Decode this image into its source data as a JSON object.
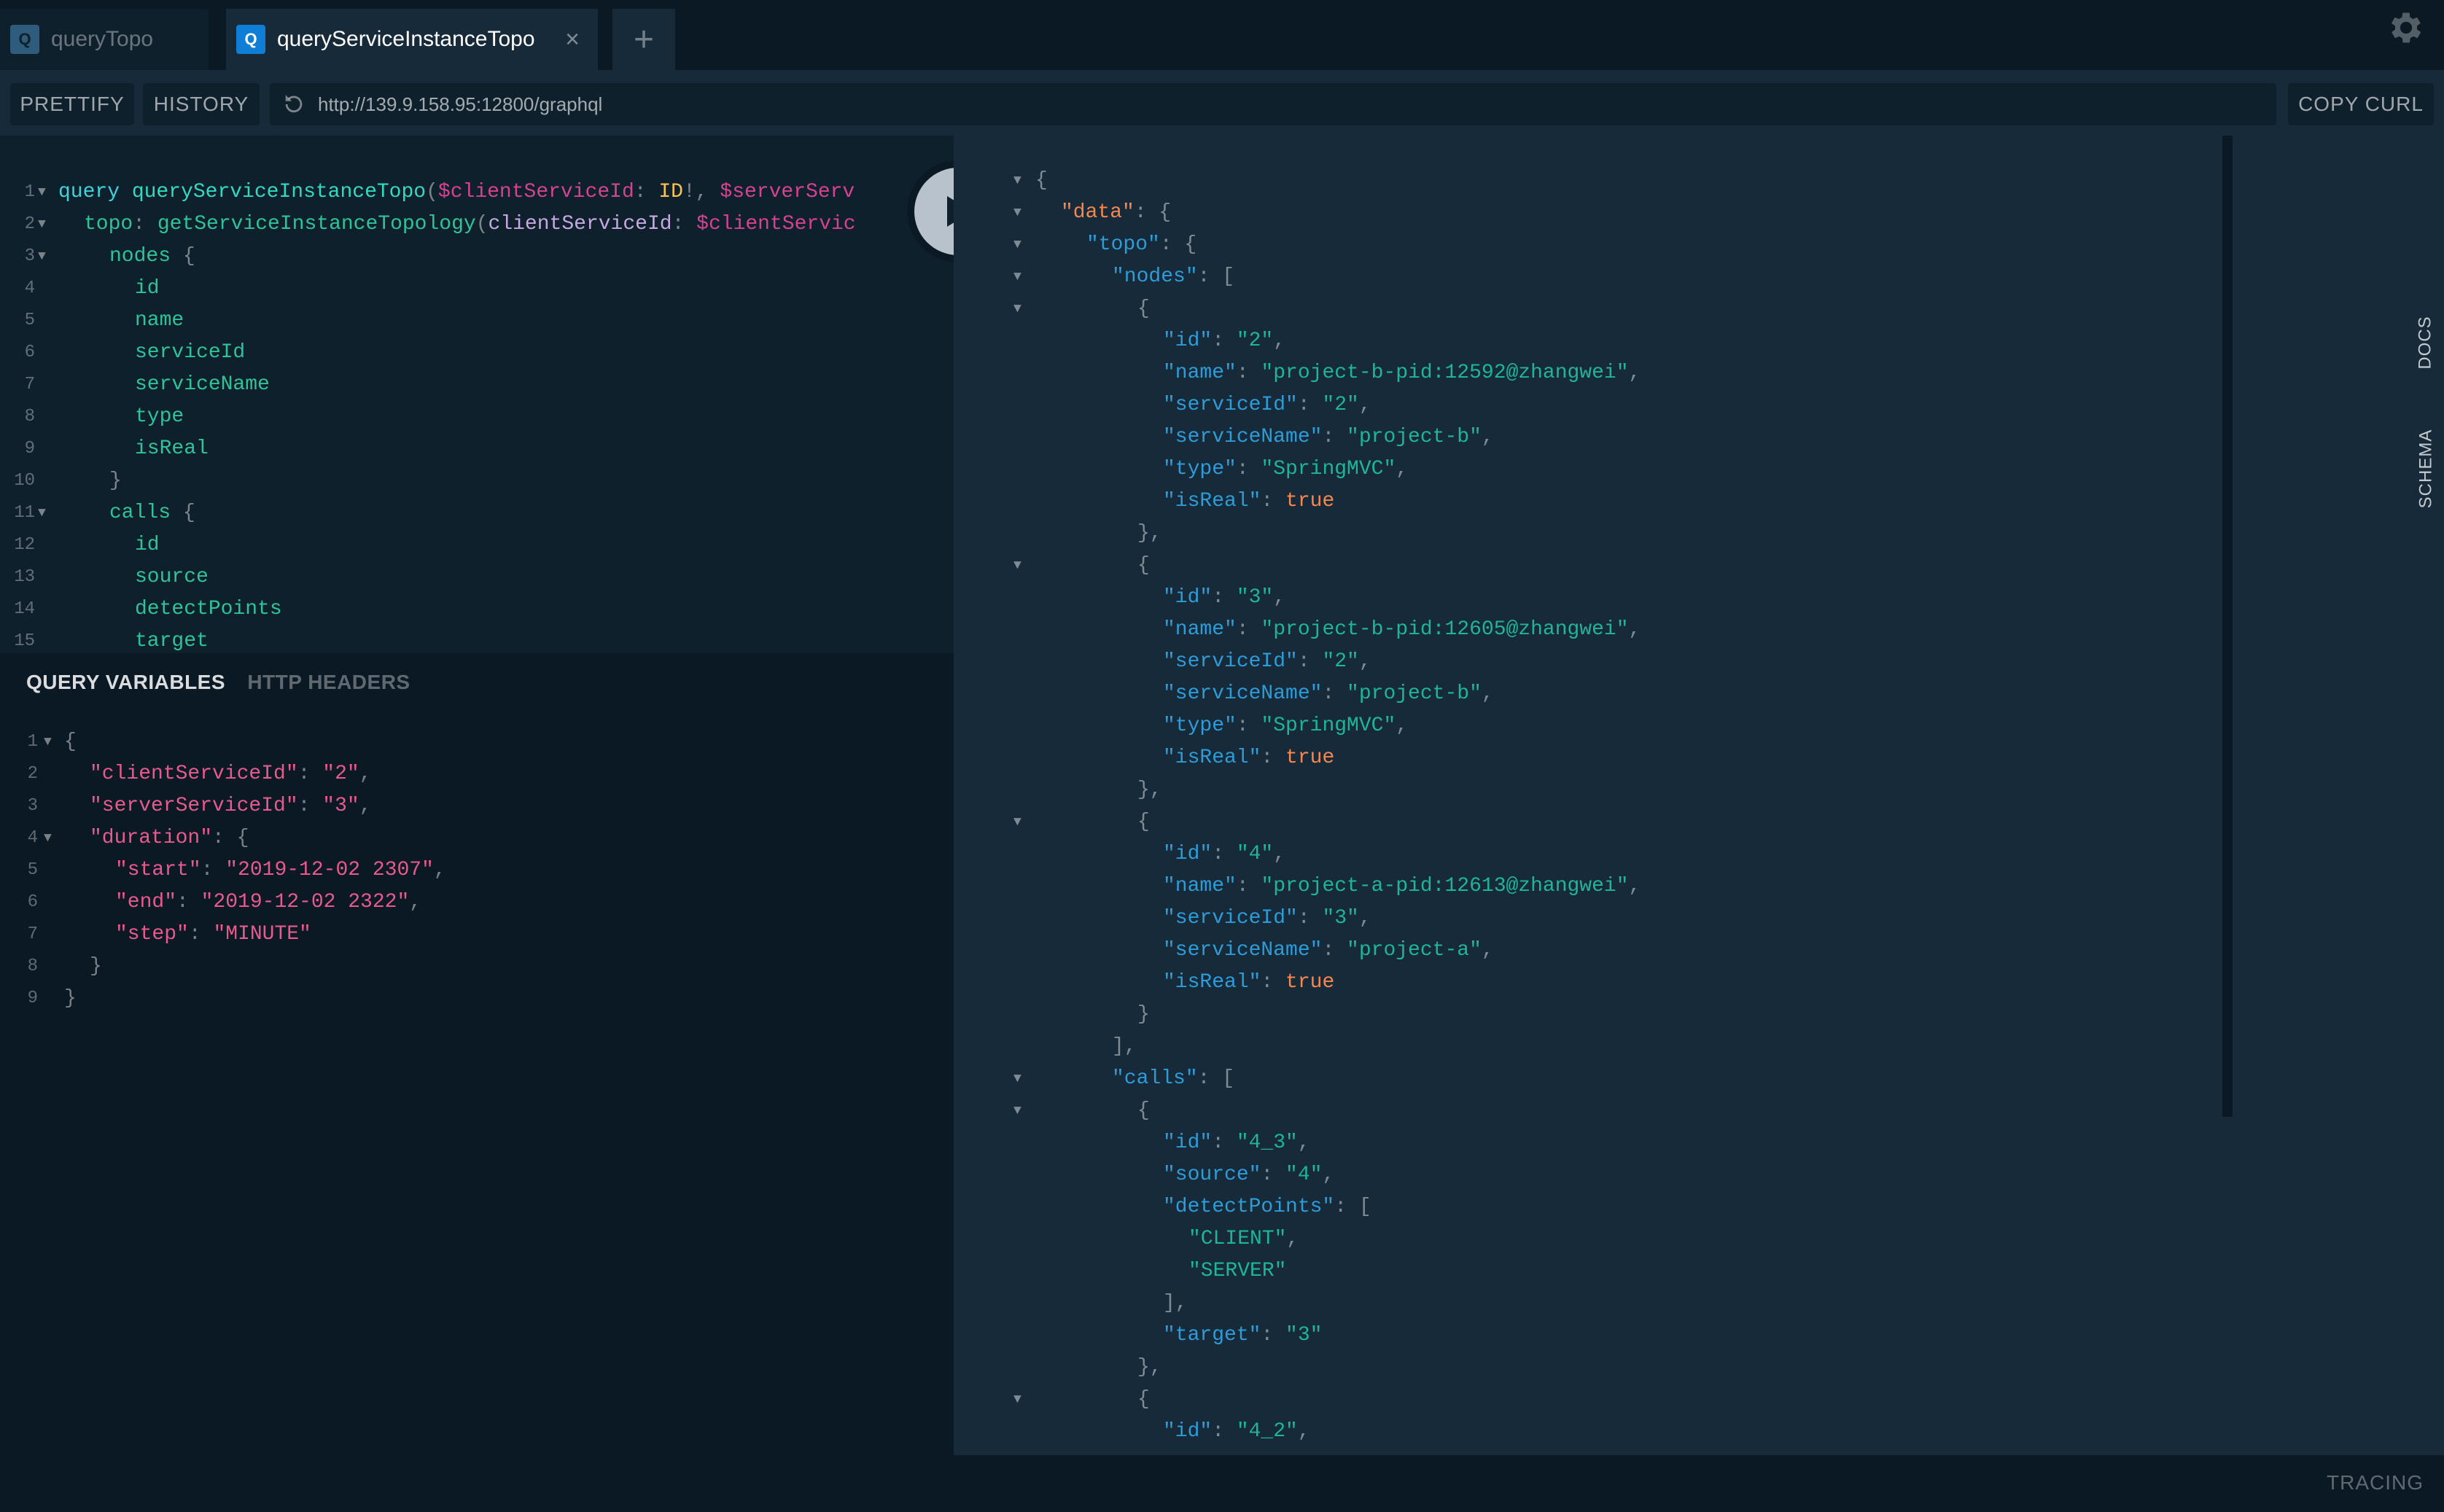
{
  "tabs": [
    {
      "icon": "Q",
      "label": "queryTopo"
    },
    {
      "icon": "Q",
      "label": "queryServiceInstanceTopo"
    }
  ],
  "add_tab_label": "+",
  "toolbar": {
    "prettify": "PRETTIFY",
    "history": "HISTORY",
    "url": "http://139.9.158.95:12800/graphql",
    "copy_curl": "COPY CURL"
  },
  "query_editor": {
    "lines": [
      {
        "n": "1",
        "fold": true,
        "indent": 0,
        "tokens": [
          {
            "t": "query ",
            "c": "kw"
          },
          {
            "t": "queryServiceInstanceTopo",
            "c": "fn"
          },
          {
            "t": "(",
            "c": "punc"
          },
          {
            "t": "$clientServiceId",
            "c": "var2"
          },
          {
            "t": ": ",
            "c": "punc"
          },
          {
            "t": "ID",
            "c": "typ"
          },
          {
            "t": "!, ",
            "c": "punc"
          },
          {
            "t": "$serverServ",
            "c": "var2"
          }
        ]
      },
      {
        "n": "2",
        "fold": true,
        "indent": 1,
        "tokens": [
          {
            "t": "topo",
            "c": "field"
          },
          {
            "t": ": ",
            "c": "punc"
          },
          {
            "t": "getServiceInstanceTopology",
            "c": "field"
          },
          {
            "t": "(",
            "c": "punc"
          },
          {
            "t": "clientServiceId",
            "c": "arg"
          },
          {
            "t": ": ",
            "c": "punc"
          },
          {
            "t": "$clientServic",
            "c": "var2"
          }
        ]
      },
      {
        "n": "3",
        "fold": true,
        "indent": 2,
        "tokens": [
          {
            "t": "nodes ",
            "c": "field"
          },
          {
            "t": "{",
            "c": "punc"
          }
        ]
      },
      {
        "n": "4",
        "fold": false,
        "indent": 3,
        "tokens": [
          {
            "t": "id",
            "c": "field"
          }
        ]
      },
      {
        "n": "5",
        "fold": false,
        "indent": 3,
        "tokens": [
          {
            "t": "name",
            "c": "field"
          }
        ]
      },
      {
        "n": "6",
        "fold": false,
        "indent": 3,
        "tokens": [
          {
            "t": "serviceId",
            "c": "field"
          }
        ]
      },
      {
        "n": "7",
        "fold": false,
        "indent": 3,
        "tokens": [
          {
            "t": "serviceName",
            "c": "field"
          }
        ]
      },
      {
        "n": "8",
        "fold": false,
        "indent": 3,
        "tokens": [
          {
            "t": "type",
            "c": "field"
          }
        ]
      },
      {
        "n": "9",
        "fold": false,
        "indent": 3,
        "tokens": [
          {
            "t": "isReal",
            "c": "field"
          }
        ]
      },
      {
        "n": "10",
        "fold": false,
        "indent": 2,
        "tokens": [
          {
            "t": "}",
            "c": "punc"
          }
        ]
      },
      {
        "n": "11",
        "fold": true,
        "indent": 2,
        "tokens": [
          {
            "t": "calls ",
            "c": "field"
          },
          {
            "t": "{",
            "c": "punc"
          }
        ]
      },
      {
        "n": "12",
        "fold": false,
        "indent": 3,
        "tokens": [
          {
            "t": "id",
            "c": "field"
          }
        ]
      },
      {
        "n": "13",
        "fold": false,
        "indent": 3,
        "tokens": [
          {
            "t": "source",
            "c": "field"
          }
        ]
      },
      {
        "n": "14",
        "fold": false,
        "indent": 3,
        "tokens": [
          {
            "t": "detectPoints",
            "c": "field"
          }
        ]
      },
      {
        "n": "15",
        "fold": false,
        "indent": 3,
        "tokens": [
          {
            "t": "target",
            "c": "field"
          }
        ]
      }
    ]
  },
  "variables_panel": {
    "tab_variables": "QUERY VARIABLES",
    "tab_headers": "HTTP HEADERS",
    "lines": [
      {
        "n": "1",
        "fold": true,
        "indent": 0,
        "tokens": [
          {
            "t": "{",
            "c": "punc"
          }
        ]
      },
      {
        "n": "2",
        "fold": false,
        "indent": 1,
        "tokens": [
          {
            "t": "\"clientServiceId\"",
            "c": "key"
          },
          {
            "t": ": ",
            "c": "punc"
          },
          {
            "t": "\"2\"",
            "c": "str"
          },
          {
            "t": ",",
            "c": "punc"
          }
        ]
      },
      {
        "n": "3",
        "fold": false,
        "indent": 1,
        "tokens": [
          {
            "t": "\"serverServiceId\"",
            "c": "key"
          },
          {
            "t": ": ",
            "c": "punc"
          },
          {
            "t": "\"3\"",
            "c": "str"
          },
          {
            "t": ",",
            "c": "punc"
          }
        ]
      },
      {
        "n": "4",
        "fold": true,
        "indent": 1,
        "tokens": [
          {
            "t": "\"duration\"",
            "c": "key"
          },
          {
            "t": ": {",
            "c": "punc"
          }
        ]
      },
      {
        "n": "5",
        "fold": false,
        "indent": 2,
        "tokens": [
          {
            "t": "\"start\"",
            "c": "key"
          },
          {
            "t": ": ",
            "c": "punc"
          },
          {
            "t": "\"2019-12-02 2307\"",
            "c": "str"
          },
          {
            "t": ",",
            "c": "punc"
          }
        ]
      },
      {
        "n": "6",
        "fold": false,
        "indent": 2,
        "tokens": [
          {
            "t": "\"end\"",
            "c": "key"
          },
          {
            "t": ": ",
            "c": "punc"
          },
          {
            "t": "\"2019-12-02 2322\"",
            "c": "str"
          },
          {
            "t": ",",
            "c": "punc"
          }
        ]
      },
      {
        "n": "7",
        "fold": false,
        "indent": 2,
        "tokens": [
          {
            "t": "\"step\"",
            "c": "key"
          },
          {
            "t": ": ",
            "c": "punc"
          },
          {
            "t": "\"MINUTE\"",
            "c": "str"
          }
        ]
      },
      {
        "n": "8",
        "fold": false,
        "indent": 1,
        "tokens": [
          {
            "t": "}",
            "c": "punc"
          }
        ]
      },
      {
        "n": "9",
        "fold": false,
        "indent": 0,
        "tokens": [
          {
            "t": "}",
            "c": "punc"
          }
        ]
      }
    ]
  },
  "result_viewer": {
    "lines": [
      {
        "fold": true,
        "indent": 0,
        "tokens": [
          {
            "t": "{",
            "c": "punc"
          }
        ]
      },
      {
        "fold": true,
        "indent": 1,
        "tokens": [
          {
            "t": "\"data\"",
            "c": "rkeyo"
          },
          {
            "t": ": {",
            "c": "punc"
          }
        ]
      },
      {
        "fold": true,
        "indent": 2,
        "tokens": [
          {
            "t": "\"topo\"",
            "c": "rkey"
          },
          {
            "t": ": {",
            "c": "punc"
          }
        ]
      },
      {
        "fold": true,
        "indent": 3,
        "tokens": [
          {
            "t": "\"nodes\"",
            "c": "rkey"
          },
          {
            "t": ": [",
            "c": "punc"
          }
        ]
      },
      {
        "fold": true,
        "indent": 4,
        "tokens": [
          {
            "t": "{",
            "c": "punc"
          }
        ]
      },
      {
        "fold": false,
        "indent": 5,
        "tokens": [
          {
            "t": "\"id\"",
            "c": "rkey"
          },
          {
            "t": ": ",
            "c": "punc"
          },
          {
            "t": "\"2\"",
            "c": "rstr"
          },
          {
            "t": ",",
            "c": "punc"
          }
        ]
      },
      {
        "fold": false,
        "indent": 5,
        "tokens": [
          {
            "t": "\"name\"",
            "c": "rkey"
          },
          {
            "t": ": ",
            "c": "punc"
          },
          {
            "t": "\"project-b-pid:12592@zhangwei\"",
            "c": "rstr"
          },
          {
            "t": ",",
            "c": "punc"
          }
        ]
      },
      {
        "fold": false,
        "indent": 5,
        "tokens": [
          {
            "t": "\"serviceId\"",
            "c": "rkey"
          },
          {
            "t": ": ",
            "c": "punc"
          },
          {
            "t": "\"2\"",
            "c": "rstr"
          },
          {
            "t": ",",
            "c": "punc"
          }
        ]
      },
      {
        "fold": false,
        "indent": 5,
        "tokens": [
          {
            "t": "\"serviceName\"",
            "c": "rkey"
          },
          {
            "t": ": ",
            "c": "punc"
          },
          {
            "t": "\"project-b\"",
            "c": "rstr"
          },
          {
            "t": ",",
            "c": "punc"
          }
        ]
      },
      {
        "fold": false,
        "indent": 5,
        "tokens": [
          {
            "t": "\"type\"",
            "c": "rkey"
          },
          {
            "t": ": ",
            "c": "punc"
          },
          {
            "t": "\"SpringMVC\"",
            "c": "rstr"
          },
          {
            "t": ",",
            "c": "punc"
          }
        ]
      },
      {
        "fold": false,
        "indent": 5,
        "tokens": [
          {
            "t": "\"isReal\"",
            "c": "rkey"
          },
          {
            "t": ": ",
            "c": "punc"
          },
          {
            "t": "true",
            "c": "rbool"
          }
        ]
      },
      {
        "fold": false,
        "indent": 4,
        "tokens": [
          {
            "t": "},",
            "c": "punc"
          }
        ]
      },
      {
        "fold": true,
        "indent": 4,
        "tokens": [
          {
            "t": "{",
            "c": "punc"
          }
        ]
      },
      {
        "fold": false,
        "indent": 5,
        "tokens": [
          {
            "t": "\"id\"",
            "c": "rkey"
          },
          {
            "t": ": ",
            "c": "punc"
          },
          {
            "t": "\"3\"",
            "c": "rstr"
          },
          {
            "t": ",",
            "c": "punc"
          }
        ]
      },
      {
        "fold": false,
        "indent": 5,
        "tokens": [
          {
            "t": "\"name\"",
            "c": "rkey"
          },
          {
            "t": ": ",
            "c": "punc"
          },
          {
            "t": "\"project-b-pid:12605@zhangwei\"",
            "c": "rstr"
          },
          {
            "t": ",",
            "c": "punc"
          }
        ]
      },
      {
        "fold": false,
        "indent": 5,
        "tokens": [
          {
            "t": "\"serviceId\"",
            "c": "rkey"
          },
          {
            "t": ": ",
            "c": "punc"
          },
          {
            "t": "\"2\"",
            "c": "rstr"
          },
          {
            "t": ",",
            "c": "punc"
          }
        ]
      },
      {
        "fold": false,
        "indent": 5,
        "tokens": [
          {
            "t": "\"serviceName\"",
            "c": "rkey"
          },
          {
            "t": ": ",
            "c": "punc"
          },
          {
            "t": "\"project-b\"",
            "c": "rstr"
          },
          {
            "t": ",",
            "c": "punc"
          }
        ]
      },
      {
        "fold": false,
        "indent": 5,
        "tokens": [
          {
            "t": "\"type\"",
            "c": "rkey"
          },
          {
            "t": ": ",
            "c": "punc"
          },
          {
            "t": "\"SpringMVC\"",
            "c": "rstr"
          },
          {
            "t": ",",
            "c": "punc"
          }
        ]
      },
      {
        "fold": false,
        "indent": 5,
        "tokens": [
          {
            "t": "\"isReal\"",
            "c": "rkey"
          },
          {
            "t": ": ",
            "c": "punc"
          },
          {
            "t": "true",
            "c": "rbool"
          }
        ]
      },
      {
        "fold": false,
        "indent": 4,
        "tokens": [
          {
            "t": "},",
            "c": "punc"
          }
        ]
      },
      {
        "fold": true,
        "indent": 4,
        "tokens": [
          {
            "t": "{",
            "c": "punc"
          }
        ]
      },
      {
        "fold": false,
        "indent": 5,
        "tokens": [
          {
            "t": "\"id\"",
            "c": "rkey"
          },
          {
            "t": ": ",
            "c": "punc"
          },
          {
            "t": "\"4\"",
            "c": "rstr"
          },
          {
            "t": ",",
            "c": "punc"
          }
        ]
      },
      {
        "fold": false,
        "indent": 5,
        "tokens": [
          {
            "t": "\"name\"",
            "c": "rkey"
          },
          {
            "t": ": ",
            "c": "punc"
          },
          {
            "t": "\"project-a-pid:12613@zhangwei\"",
            "c": "rstr"
          },
          {
            "t": ",",
            "c": "punc"
          }
        ]
      },
      {
        "fold": false,
        "indent": 5,
        "tokens": [
          {
            "t": "\"serviceId\"",
            "c": "rkey"
          },
          {
            "t": ": ",
            "c": "punc"
          },
          {
            "t": "\"3\"",
            "c": "rstr"
          },
          {
            "t": ",",
            "c": "punc"
          }
        ]
      },
      {
        "fold": false,
        "indent": 5,
        "tokens": [
          {
            "t": "\"serviceName\"",
            "c": "rkey"
          },
          {
            "t": ": ",
            "c": "punc"
          },
          {
            "t": "\"project-a\"",
            "c": "rstr"
          },
          {
            "t": ",",
            "c": "punc"
          }
        ]
      },
      {
        "fold": false,
        "indent": 5,
        "tokens": [
          {
            "t": "\"isReal\"",
            "c": "rkey"
          },
          {
            "t": ": ",
            "c": "punc"
          },
          {
            "t": "true",
            "c": "rbool"
          }
        ]
      },
      {
        "fold": false,
        "indent": 4,
        "tokens": [
          {
            "t": "}",
            "c": "punc"
          }
        ]
      },
      {
        "fold": false,
        "indent": 3,
        "tokens": [
          {
            "t": "],",
            "c": "punc"
          }
        ]
      },
      {
        "fold": true,
        "indent": 3,
        "tokens": [
          {
            "t": "\"calls\"",
            "c": "rkey"
          },
          {
            "t": ": [",
            "c": "punc"
          }
        ]
      },
      {
        "fold": true,
        "indent": 4,
        "tokens": [
          {
            "t": "{",
            "c": "punc"
          }
        ]
      },
      {
        "fold": false,
        "indent": 5,
        "tokens": [
          {
            "t": "\"id\"",
            "c": "rkey"
          },
          {
            "t": ": ",
            "c": "punc"
          },
          {
            "t": "\"4_3\"",
            "c": "rstr"
          },
          {
            "t": ",",
            "c": "punc"
          }
        ]
      },
      {
        "fold": false,
        "indent": 5,
        "tokens": [
          {
            "t": "\"source\"",
            "c": "rkey"
          },
          {
            "t": ": ",
            "c": "punc"
          },
          {
            "t": "\"4\"",
            "c": "rstr"
          },
          {
            "t": ",",
            "c": "punc"
          }
        ]
      },
      {
        "fold": false,
        "indent": 5,
        "tokens": [
          {
            "t": "\"detectPoints\"",
            "c": "rkey"
          },
          {
            "t": ": [",
            "c": "punc"
          }
        ]
      },
      {
        "fold": false,
        "indent": 6,
        "tokens": [
          {
            "t": "\"CLIENT\"",
            "c": "rstr"
          },
          {
            "t": ",",
            "c": "punc"
          }
        ]
      },
      {
        "fold": false,
        "indent": 6,
        "tokens": [
          {
            "t": "\"SERVER\"",
            "c": "rstr"
          }
        ]
      },
      {
        "fold": false,
        "indent": 5,
        "tokens": [
          {
            "t": "],",
            "c": "punc"
          }
        ]
      },
      {
        "fold": false,
        "indent": 5,
        "tokens": [
          {
            "t": "\"target\"",
            "c": "rkey"
          },
          {
            "t": ": ",
            "c": "punc"
          },
          {
            "t": "\"3\"",
            "c": "rstr"
          }
        ]
      },
      {
        "fold": false,
        "indent": 4,
        "tokens": [
          {
            "t": "},",
            "c": "punc"
          }
        ]
      },
      {
        "fold": true,
        "indent": 4,
        "tokens": [
          {
            "t": "{",
            "c": "punc"
          }
        ]
      },
      {
        "fold": false,
        "indent": 5,
        "tokens": [
          {
            "t": "\"id\"",
            "c": "rkey"
          },
          {
            "t": ": ",
            "c": "punc"
          },
          {
            "t": "\"4_2\"",
            "c": "rstr"
          },
          {
            "t": ",",
            "c": "punc"
          }
        ]
      }
    ]
  },
  "side_tabs": {
    "docs": "DOCS",
    "schema": "SCHEMA"
  },
  "footer": {
    "tracing": "TRACING"
  },
  "icons": {
    "settings": "gear-icon",
    "run": "play-icon",
    "reload": "reload-icon",
    "close": "close-icon",
    "add": "plus-icon"
  }
}
